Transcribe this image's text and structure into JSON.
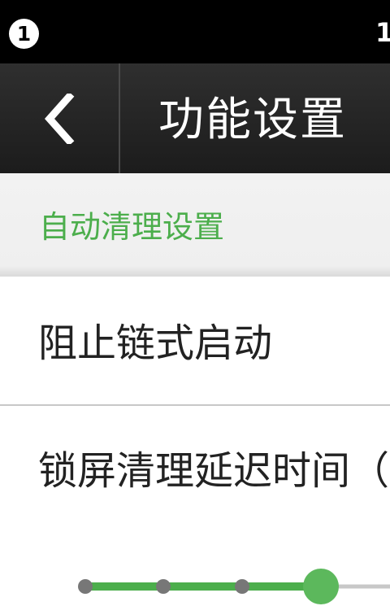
{
  "status_bar": {
    "notification_count": "1",
    "right_text": "1"
  },
  "action_bar": {
    "back_icon": "chevron-left-icon",
    "title": "功能设置"
  },
  "section": {
    "title": "自动清理设置"
  },
  "rows": [
    {
      "label": "阻止链式启动"
    },
    {
      "label": "锁屏清理延迟时间（"
    }
  ],
  "slider": {
    "stops_visible": 4,
    "selected_stop_index": 3
  },
  "colors": {
    "accent_green": "#4cae4c",
    "action_bar_bg": "#262626",
    "status_bar_bg": "#000000",
    "section_bg": "#f0f0f0",
    "slider_dot_inactive": "#777777",
    "slider_track_inactive": "#c8c8c8"
  }
}
